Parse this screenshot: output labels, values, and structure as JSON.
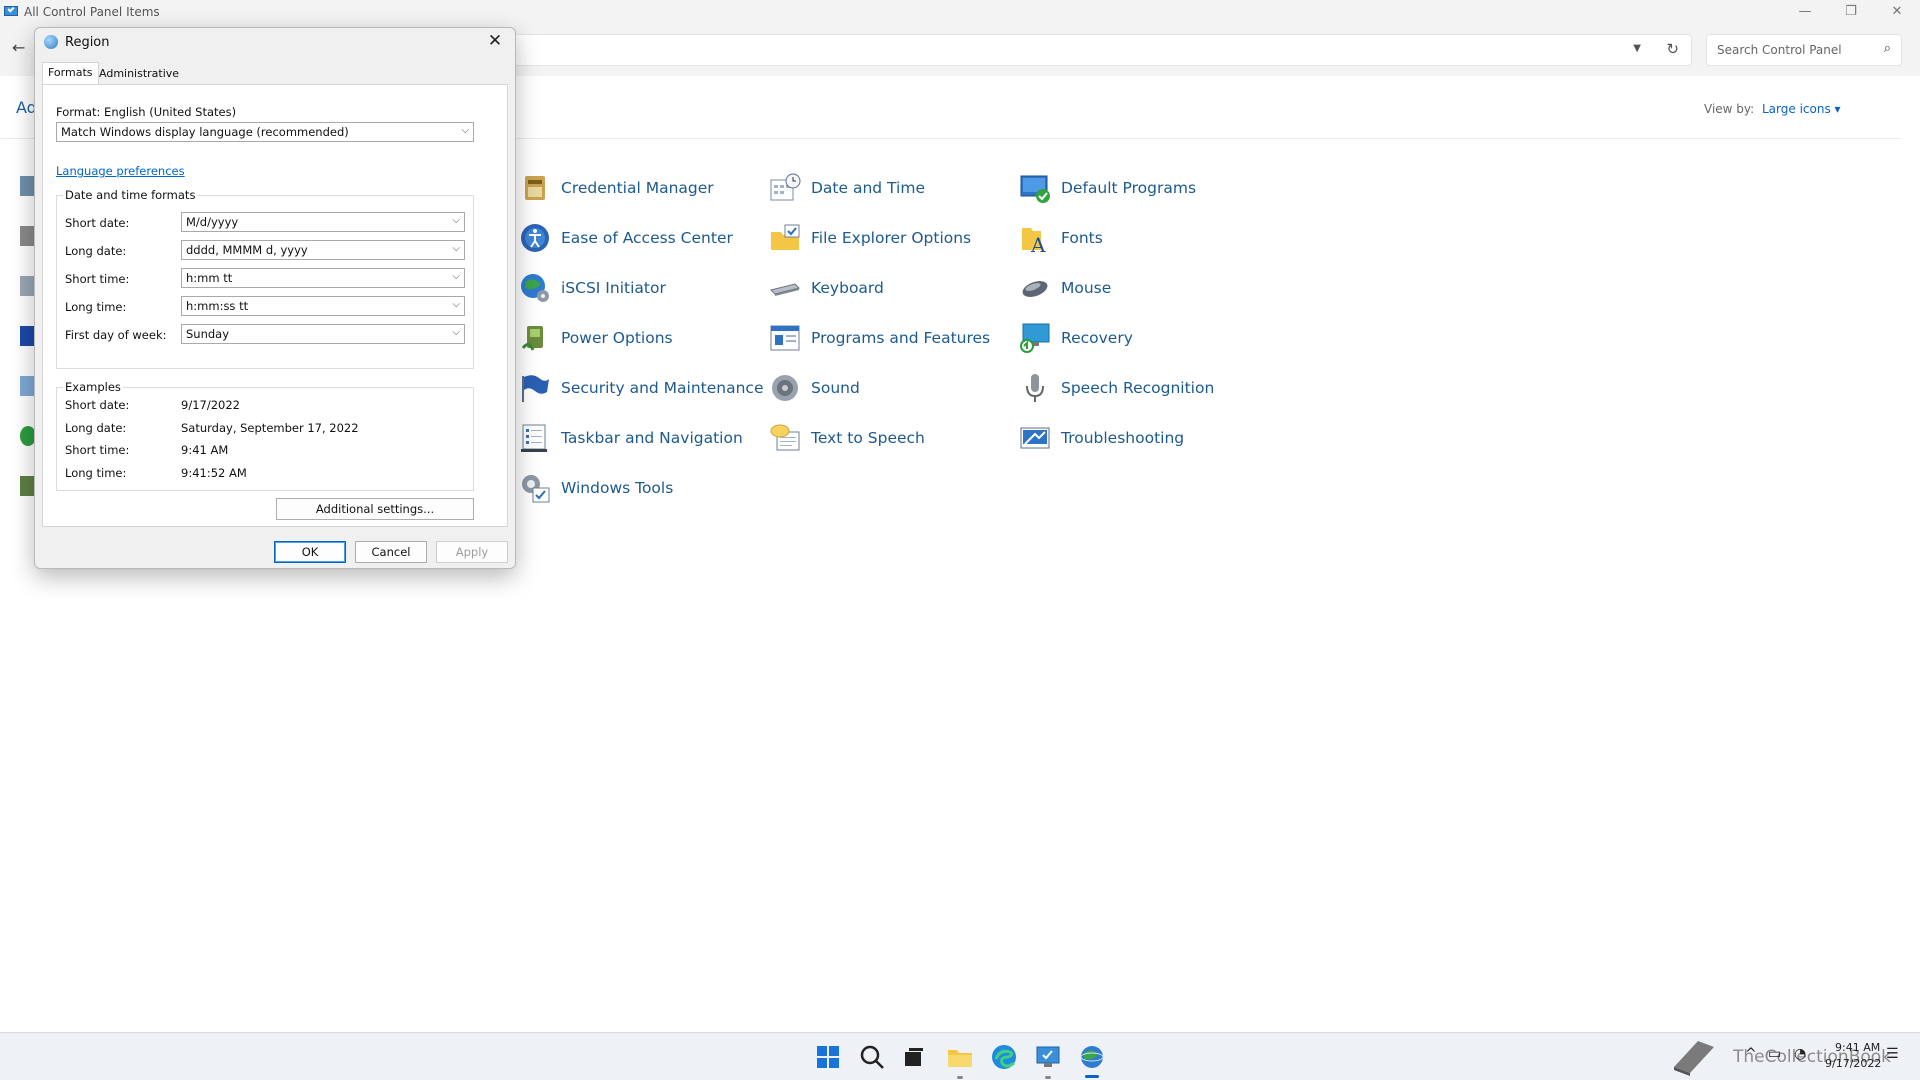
{
  "window": {
    "title": "All Control Panel Items",
    "search_placeholder": "Search Control Panel",
    "adjust_label_partial": "Ad",
    "view_by_label": "View by:",
    "view_by_value": "Large icons"
  },
  "items": [
    {
      "label": "Credential Manager",
      "icon": "credential-manager-icon"
    },
    {
      "label": "Date and Time",
      "icon": "date-time-icon"
    },
    {
      "label": "Default Programs",
      "icon": "default-programs-icon"
    },
    {
      "label": "Ease of Access Center",
      "icon": "ease-of-access-icon"
    },
    {
      "label": "File Explorer Options",
      "icon": "folder-options-icon"
    },
    {
      "label": "Fonts",
      "icon": "fonts-icon"
    },
    {
      "label": "iSCSI Initiator",
      "icon": "iscsi-icon"
    },
    {
      "label": "Keyboard",
      "icon": "keyboard-icon"
    },
    {
      "label": "Mouse",
      "icon": "mouse-icon"
    },
    {
      "label": "Power Options",
      "icon": "power-options-icon"
    },
    {
      "label": "Programs and Features",
      "icon": "programs-features-icon"
    },
    {
      "label": "Recovery",
      "icon": "recovery-icon"
    },
    {
      "label": "Security and Maintenance",
      "icon": "security-flag-icon"
    },
    {
      "label": "Sound",
      "icon": "sound-icon"
    },
    {
      "label": "Speech Recognition",
      "icon": "microphone-icon"
    },
    {
      "label": "Taskbar and Navigation",
      "icon": "taskbar-icon"
    },
    {
      "label": "Text to Speech",
      "icon": "speech-bubble-icon"
    },
    {
      "label": "Troubleshooting",
      "icon": "troubleshooting-icon"
    },
    {
      "label": "Windows Tools",
      "icon": "windows-tools-icon"
    }
  ],
  "dialog": {
    "title": "Region",
    "tabs": [
      "Formats",
      "Administrative"
    ],
    "format_label": "Format: English (United States)",
    "format_value": "Match Windows display language (recommended)",
    "language_link": "Language preferences",
    "dt_group_title": "Date and time formats",
    "fields": [
      {
        "label": "Short date:",
        "value": "M/d/yyyy"
      },
      {
        "label": "Long date:",
        "value": "dddd, MMMM d, yyyy"
      },
      {
        "label": "Short time:",
        "value": "h:mm tt"
      },
      {
        "label": "Long time:",
        "value": "h:mm:ss tt"
      },
      {
        "label": "First day of week:",
        "value": "Sunday"
      }
    ],
    "examples_title": "Examples",
    "examples": [
      {
        "label": "Short date:",
        "value": "9/17/2022"
      },
      {
        "label": "Long date:",
        "value": "Saturday, September 17, 2022"
      },
      {
        "label": "Short time:",
        "value": "9:41 AM"
      },
      {
        "label": "Long time:",
        "value": "9:41:52 AM"
      }
    ],
    "additional_button": "Additional settings...",
    "ok_button": "OK",
    "cancel_button": "Cancel",
    "apply_button": "Apply"
  },
  "taskbar": {
    "watermark": "TheCollectionBook",
    "time": "9:41 AM",
    "date": "9/17/2022"
  }
}
